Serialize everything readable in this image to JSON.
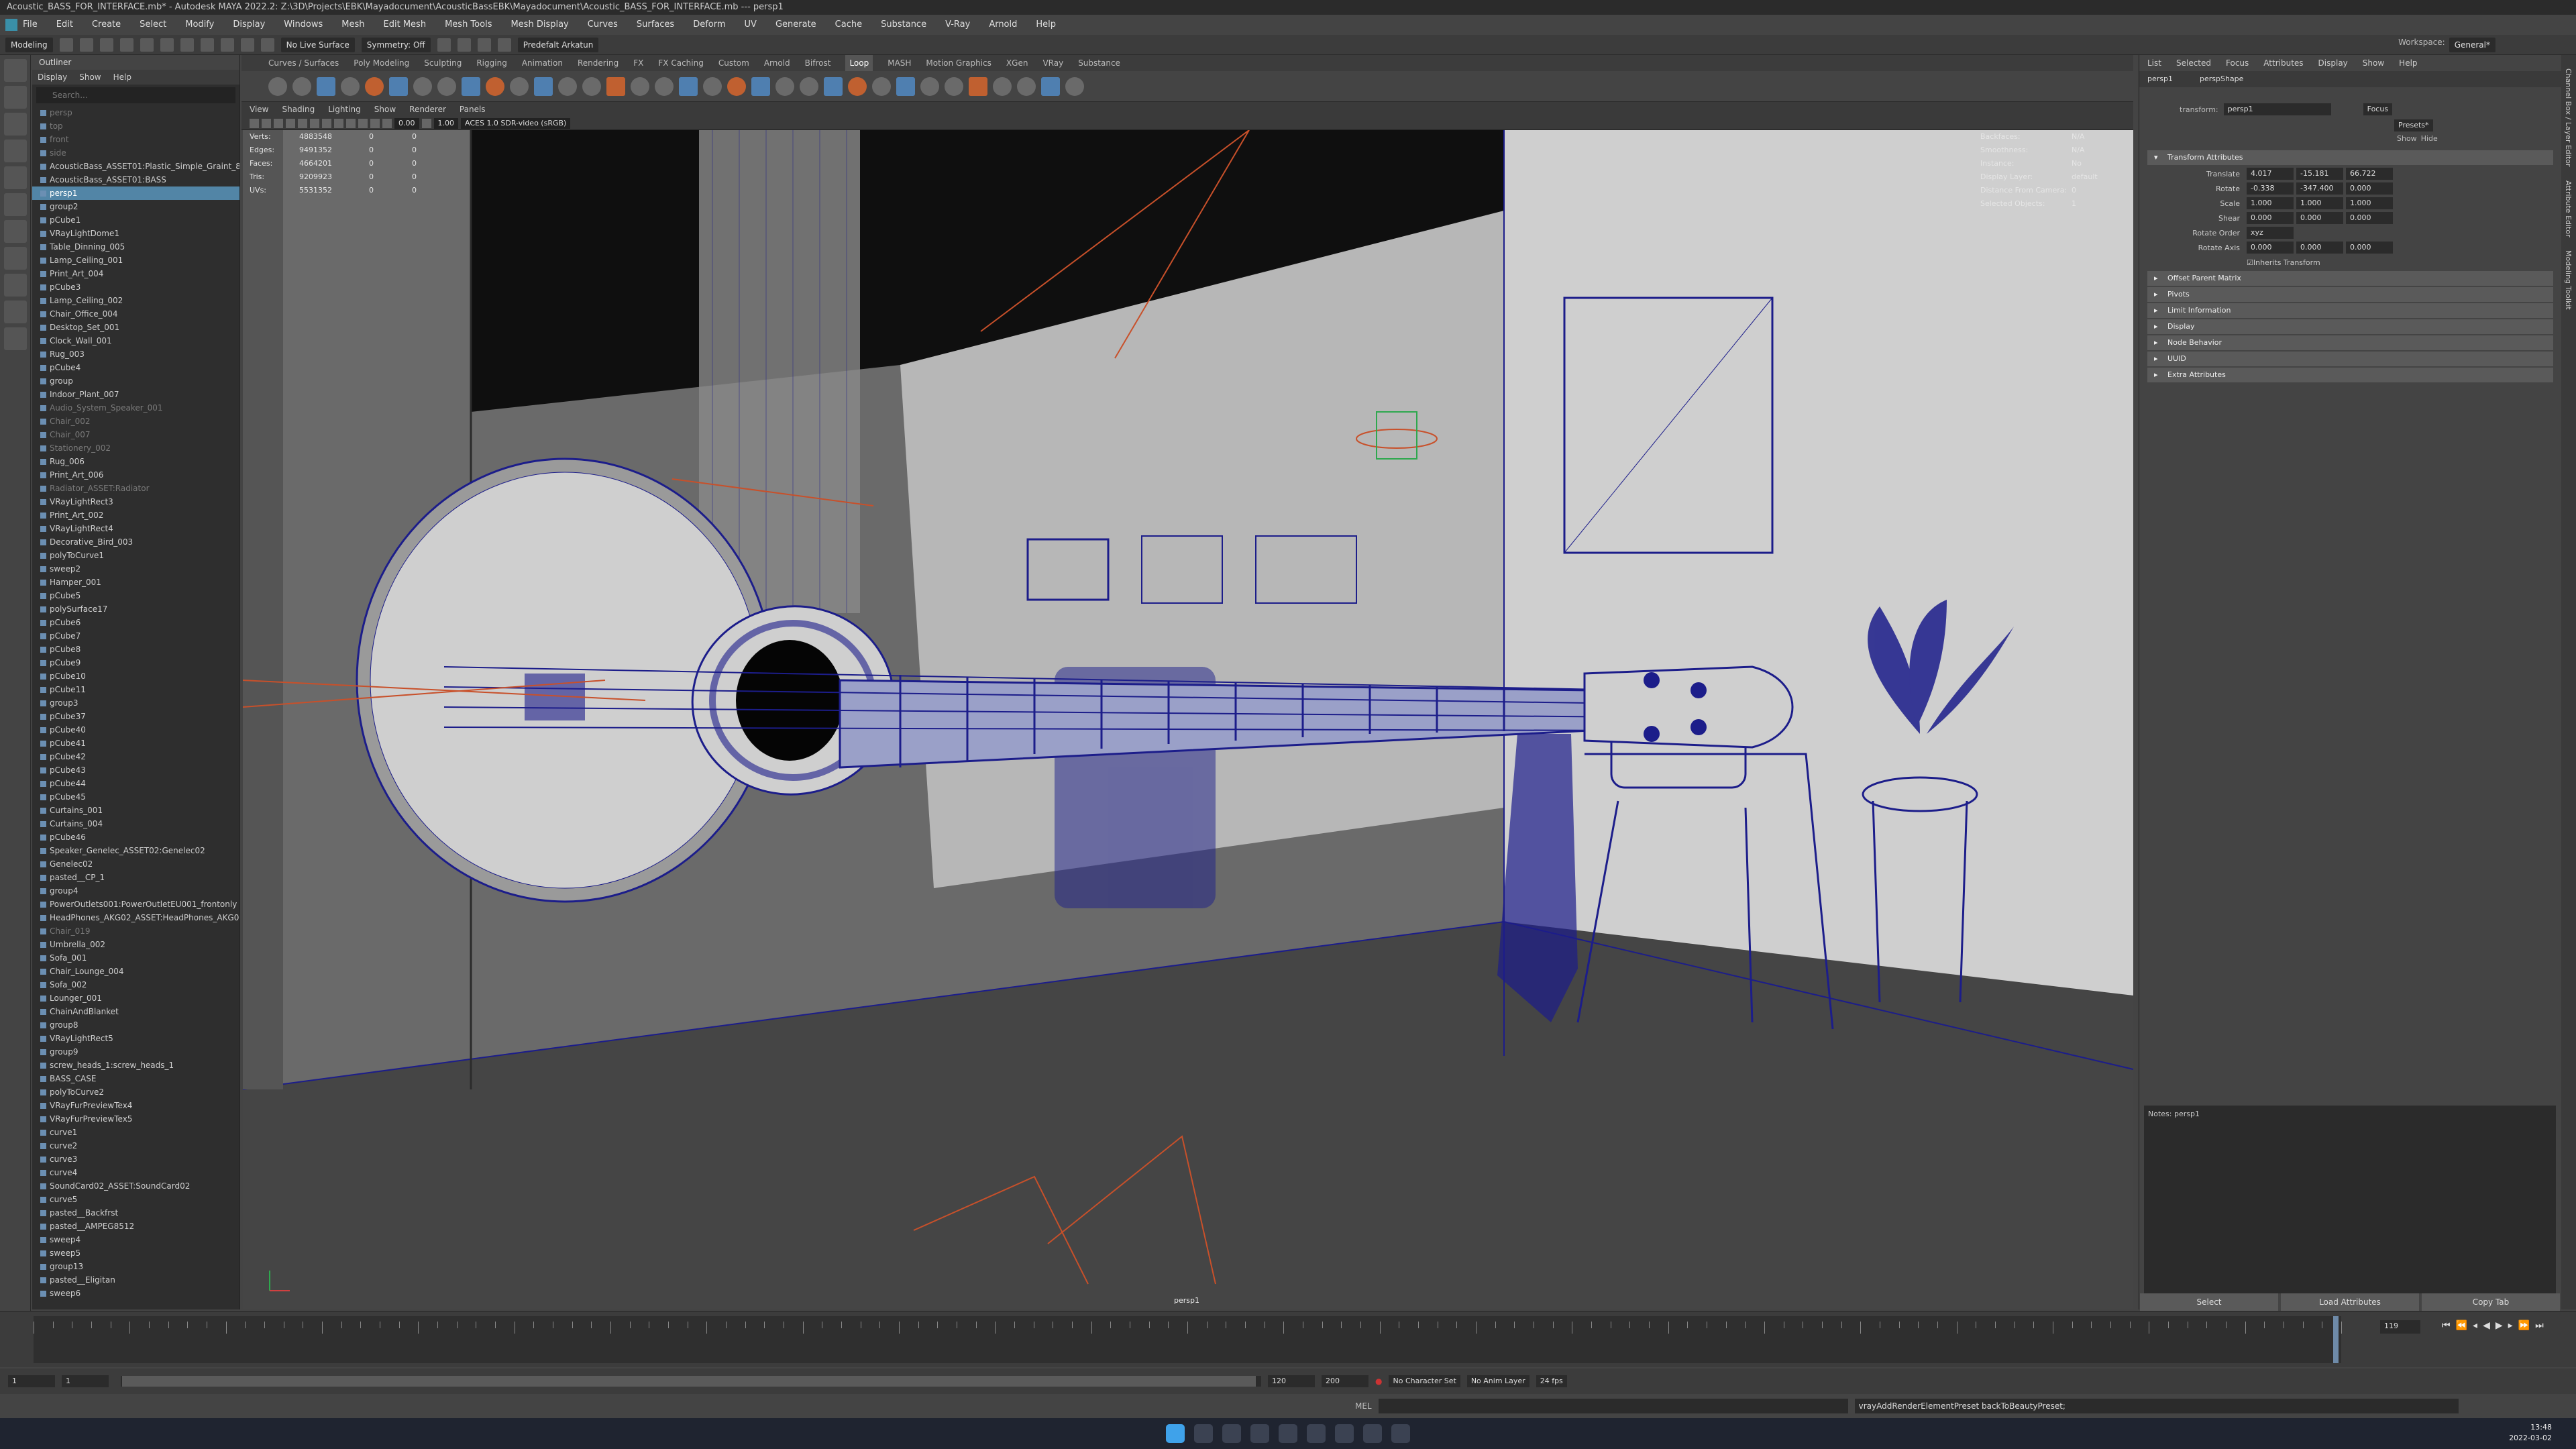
{
  "app": {
    "title": "Acoustic_BASS_FOR_INTERFACE.mb* - Autodesk MAYA 2022.2: Z:\\3D\\Projects\\EBK\\Mayadocument\\AcousticBassEBK\\Mayadocument\\Acoustic_BASS_FOR_INTERFACE.mb --- persp1",
    "menus": [
      "File",
      "Edit",
      "Create",
      "Select",
      "Modify",
      "Display",
      "Windows",
      "Mesh",
      "Edit Mesh",
      "Mesh Tools",
      "Mesh Display",
      "Curves",
      "Surfaces",
      "Deform",
      "UV",
      "Generate",
      "Cache",
      "Substance",
      "V-Ray",
      "Arnold",
      "Help"
    ],
    "workspace_label": "Workspace:",
    "workspace_value": "General*"
  },
  "statusline": {
    "mode": "Modeling",
    "live_surface": "No Live Surface",
    "symmetry": "Symmetry: Off",
    "renderer_preset": "Predefalt Arkatun"
  },
  "shelf": {
    "tabs": [
      "Curves / Surfaces",
      "Poly Modeling",
      "Sculpting",
      "Rigging",
      "Animation",
      "Rendering",
      "FX",
      "FX Caching",
      "Custom",
      "Arnold",
      "Bifrost",
      "Loop",
      "MASH",
      "Motion Graphics",
      "XGen",
      "VRay",
      "Substance"
    ],
    "active_tab": "Loop"
  },
  "outliner": {
    "title": "Outliner",
    "menu": [
      "Display",
      "Show",
      "Help"
    ],
    "search_placeholder": "Search...",
    "items": [
      {
        "label": "persp",
        "state": "dim"
      },
      {
        "label": "top",
        "state": "dim"
      },
      {
        "label": "front",
        "state": "dim"
      },
      {
        "label": "side",
        "state": "dim"
      },
      {
        "label": "AcousticBass_ASSET01:Plastic_Simple_Graint_8",
        "state": ""
      },
      {
        "label": "AcousticBass_ASSET01:BASS",
        "state": ""
      },
      {
        "label": "persp1",
        "state": "sel"
      },
      {
        "label": "group2",
        "state": ""
      },
      {
        "label": "pCube1",
        "state": ""
      },
      {
        "label": "VRayLightDome1",
        "state": ""
      },
      {
        "label": "Table_Dinning_005",
        "state": ""
      },
      {
        "label": "Lamp_Ceiling_001",
        "state": ""
      },
      {
        "label": "Print_Art_004",
        "state": ""
      },
      {
        "label": "pCube3",
        "state": ""
      },
      {
        "label": "Lamp_Ceiling_002",
        "state": ""
      },
      {
        "label": "Chair_Office_004",
        "state": ""
      },
      {
        "label": "Desktop_Set_001",
        "state": ""
      },
      {
        "label": "Clock_Wall_001",
        "state": ""
      },
      {
        "label": "Rug_003",
        "state": ""
      },
      {
        "label": "pCube4",
        "state": ""
      },
      {
        "label": "group",
        "state": ""
      },
      {
        "label": "Indoor_Plant_007",
        "state": ""
      },
      {
        "label": "Audio_System_Speaker_001",
        "state": "dim"
      },
      {
        "label": "Chair_002",
        "state": "dim"
      },
      {
        "label": "Chair_007",
        "state": "dim"
      },
      {
        "label": "Stationery_002",
        "state": "dim"
      },
      {
        "label": "Rug_006",
        "state": ""
      },
      {
        "label": "Print_Art_006",
        "state": ""
      },
      {
        "label": "Radiator_ASSET:Radiator",
        "state": "dim"
      },
      {
        "label": "VRayLightRect3",
        "state": ""
      },
      {
        "label": "Print_Art_002",
        "state": ""
      },
      {
        "label": "VRayLightRect4",
        "state": ""
      },
      {
        "label": "Decorative_Bird_003",
        "state": ""
      },
      {
        "label": "polyToCurve1",
        "state": ""
      },
      {
        "label": "sweep2",
        "state": ""
      },
      {
        "label": "Hamper_001",
        "state": ""
      },
      {
        "label": "pCube5",
        "state": ""
      },
      {
        "label": "polySurface17",
        "state": ""
      },
      {
        "label": "pCube6",
        "state": ""
      },
      {
        "label": "pCube7",
        "state": ""
      },
      {
        "label": "pCube8",
        "state": ""
      },
      {
        "label": "pCube9",
        "state": ""
      },
      {
        "label": "pCube10",
        "state": ""
      },
      {
        "label": "pCube11",
        "state": ""
      },
      {
        "label": "group3",
        "state": ""
      },
      {
        "label": "pCube37",
        "state": ""
      },
      {
        "label": "pCube40",
        "state": ""
      },
      {
        "label": "pCube41",
        "state": ""
      },
      {
        "label": "pCube42",
        "state": ""
      },
      {
        "label": "pCube43",
        "state": ""
      },
      {
        "label": "pCube44",
        "state": ""
      },
      {
        "label": "pCube45",
        "state": ""
      },
      {
        "label": "Curtains_001",
        "state": ""
      },
      {
        "label": "Curtains_004",
        "state": ""
      },
      {
        "label": "pCube46",
        "state": ""
      },
      {
        "label": "Speaker_Genelec_ASSET02:Genelec02",
        "state": ""
      },
      {
        "label": "Genelec02",
        "state": ""
      },
      {
        "label": "pasted__CP_1",
        "state": ""
      },
      {
        "label": "group4",
        "state": ""
      },
      {
        "label": "PowerOutlets001:PowerOutletEU001_frontonly",
        "state": ""
      },
      {
        "label": "HeadPhones_AKG02_ASSET:HeadPhones_AKG02",
        "state": ""
      },
      {
        "label": "Chair_019",
        "state": "dim"
      },
      {
        "label": "Umbrella_002",
        "state": ""
      },
      {
        "label": "Sofa_001",
        "state": ""
      },
      {
        "label": "Chair_Lounge_004",
        "state": ""
      },
      {
        "label": "Sofa_002",
        "state": ""
      },
      {
        "label": "Lounger_001",
        "state": ""
      },
      {
        "label": "ChainAndBlanket",
        "state": ""
      },
      {
        "label": "group8",
        "state": ""
      },
      {
        "label": "VRayLightRect5",
        "state": ""
      },
      {
        "label": "group9",
        "state": ""
      },
      {
        "label": "screw_heads_1:screw_heads_1",
        "state": ""
      },
      {
        "label": "BASS_CASE",
        "state": ""
      },
      {
        "label": "polyToCurve2",
        "state": ""
      },
      {
        "label": "VRayFurPreviewTex4",
        "state": ""
      },
      {
        "label": "VRayFurPreviewTex5",
        "state": ""
      },
      {
        "label": "curve1",
        "state": ""
      },
      {
        "label": "curve2",
        "state": ""
      },
      {
        "label": "curve3",
        "state": ""
      },
      {
        "label": "curve4",
        "state": ""
      },
      {
        "label": "SoundCard02_ASSET:SoundCard02",
        "state": ""
      },
      {
        "label": "curve5",
        "state": ""
      },
      {
        "label": "pasted__Backfrst",
        "state": ""
      },
      {
        "label": "pasted__AMPEG8512",
        "state": ""
      },
      {
        "label": "sweep4",
        "state": ""
      },
      {
        "label": "sweep5",
        "state": ""
      },
      {
        "label": "group13",
        "state": ""
      },
      {
        "label": "pasted__Eligitan",
        "state": ""
      },
      {
        "label": "sweep6",
        "state": ""
      }
    ]
  },
  "panel": {
    "menu": [
      "View",
      "Shading",
      "Lighting",
      "Show",
      "Renderer",
      "Panels"
    ],
    "exposure": "0.00",
    "gamma": "1.00",
    "color_space": "ACES 1.0 SDR-video (sRGB)",
    "camera_label": "persp1"
  },
  "hud": {
    "rows": [
      {
        "k": "Verts:",
        "v1": "4883548",
        "v2": "0",
        "v3": "0"
      },
      {
        "k": "Edges:",
        "v1": "9491352",
        "v2": "0",
        "v3": "0"
      },
      {
        "k": "Faces:",
        "v1": "4664201",
        "v2": "0",
        "v3": "0"
      },
      {
        "k": "Tris:",
        "v1": "9209923",
        "v2": "0",
        "v3": "0"
      },
      {
        "k": "UVs:",
        "v1": "5531352",
        "v2": "0",
        "v3": "0"
      }
    ],
    "right_rows": [
      {
        "k": "Backfaces:",
        "v": "N/A"
      },
      {
        "k": "Smoothness:",
        "v": "N/A"
      },
      {
        "k": "Instance:",
        "v": "No"
      },
      {
        "k": "Display Layer:",
        "v": "default"
      },
      {
        "k": "Distance From Camera:",
        "v": "0"
      },
      {
        "k": "Selected Objects:",
        "v": "1"
      }
    ]
  },
  "attribute_editor": {
    "menu": [
      "List",
      "Selected",
      "Focus",
      "Attributes",
      "Display",
      "Show",
      "Help"
    ],
    "tabs": [
      "persp1",
      "perspShape"
    ],
    "transform_label": "transform:",
    "transform_value": "persp1",
    "focus_btn": "Focus",
    "presets_btn": "Presets*",
    "show_btn": "Show",
    "hide_btn": "Hide",
    "section_open": "Transform Attributes",
    "rows": [
      {
        "lbl": "Translate",
        "a": "4.017",
        "b": "-15.181",
        "c": "66.722"
      },
      {
        "lbl": "Rotate",
        "a": "-0.338",
        "b": "-347.400",
        "c": "0.000"
      },
      {
        "lbl": "Scale",
        "a": "1.000",
        "b": "1.000",
        "c": "1.000"
      },
      {
        "lbl": "Shear",
        "a": "0.000",
        "b": "0.000",
        "c": "0.000"
      }
    ],
    "rotate_order_label": "Rotate Order",
    "rotate_order_value": "xyz",
    "rotate_axis_label": "Rotate Axis",
    "rotate_axis": {
      "a": "0.000",
      "b": "0.000",
      "c": "0.000"
    },
    "inherits_label": "Inherits Transform",
    "sections": [
      "Offset Parent Matrix",
      "Pivots",
      "Limit Information",
      "Display",
      "Node Behavior",
      "UUID",
      "Extra Attributes"
    ],
    "notes_label": "Notes:  persp1",
    "buttons": [
      "Select",
      "Load Attributes",
      "Copy Tab"
    ],
    "side_tabs": [
      "Channel Box / Layer Editor",
      "Attribute Editor",
      "Modeling Toolkit"
    ]
  },
  "timeline": {
    "current_frame": "119",
    "frame_field": "119",
    "range_start": "1",
    "range_start2": "1",
    "range_label_mid": "1",
    "range_end_inner": "120",
    "range_end": "120",
    "range_end2": "200",
    "character_set": "No Character Set",
    "anim_layer": "No Anim Layer",
    "fps": "24 fps"
  },
  "cmdline": {
    "label": "MEL",
    "result": "vrayAddRenderElementPreset backToBeautyPreset;"
  },
  "taskbar": {
    "time": "13:48",
    "date": "2022-03-02"
  },
  "colors": {
    "wire": "#1c1d8a",
    "selected_row": "#5285a6",
    "light_wire": "#c8502a"
  }
}
